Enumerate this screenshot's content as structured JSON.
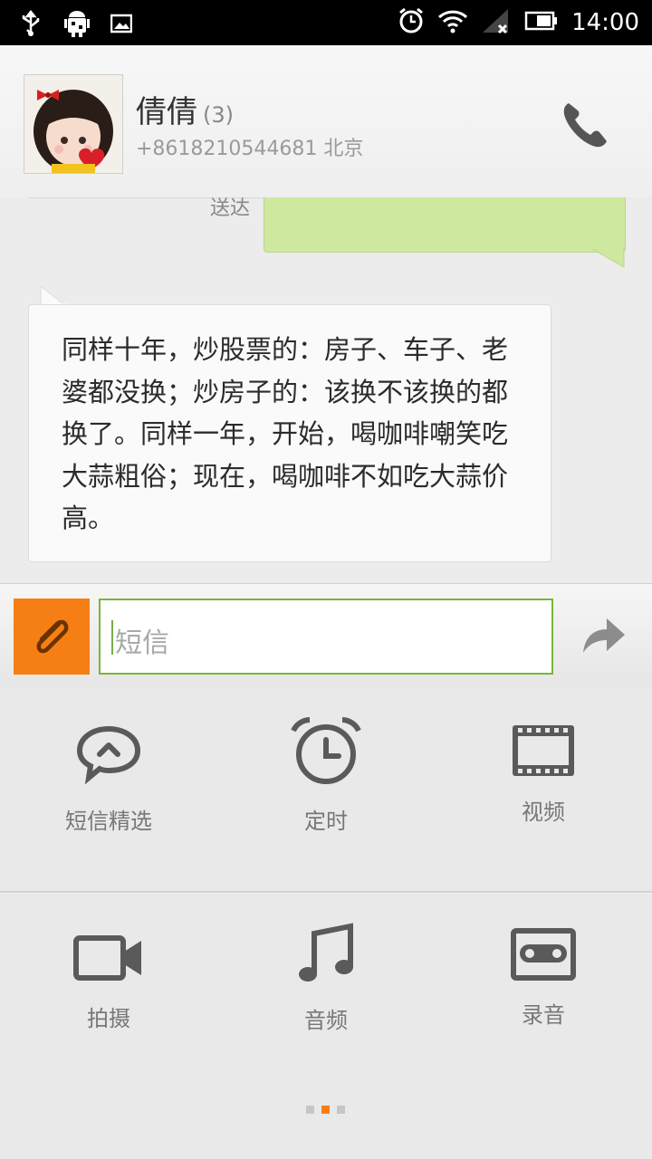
{
  "status_bar": {
    "time": "14:00",
    "icons": [
      "usb-icon",
      "android-debug-icon",
      "image-icon",
      "alarm-icon",
      "wifi-icon",
      "signal-icon",
      "battery-icon"
    ]
  },
  "contact": {
    "name": "倩倩",
    "count": "(3)",
    "phone_location": "+8618210544681 北京"
  },
  "messages": {
    "sent_status": "送达",
    "received_text": "同样十年，炒股票的：房子、车子、老婆都没换；炒房子的：该换不该换的都换了。同样一年，开始，喝咖啡嘲笑吃大蒜粗俗；现在，喝咖啡不如吃大蒜价高。"
  },
  "composer": {
    "placeholder": "短信"
  },
  "attachments": [
    {
      "label": "短信精选",
      "icon": "quick-sms-icon"
    },
    {
      "label": "定时",
      "icon": "timer-icon"
    },
    {
      "label": "视频",
      "icon": "video-icon"
    },
    {
      "label": "拍摄",
      "icon": "camera-icon"
    },
    {
      "label": "音频",
      "icon": "music-icon"
    },
    {
      "label": "录音",
      "icon": "recorder-icon"
    }
  ],
  "pager": {
    "count": 3,
    "active": 1
  },
  "colors": {
    "accent_orange": "#f57f15",
    "input_border_green": "#78b637",
    "sent_bubble_green": "#cfe89f"
  }
}
